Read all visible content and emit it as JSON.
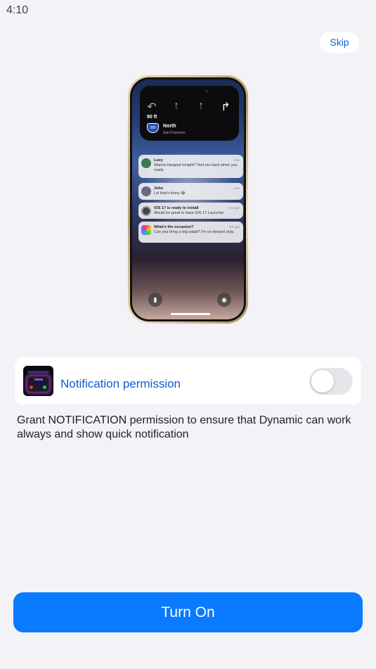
{
  "status": {
    "time": "4:10"
  },
  "header": {
    "skip_label": "Skip"
  },
  "phone": {
    "nav": {
      "distance": "90 ft",
      "route": "280",
      "street": "North",
      "city": "San Francisco"
    },
    "notifications": [
      {
        "title": "Lucy",
        "body": "Wanna hangout tonight? Text me back when you ready",
        "time": "now",
        "icon_color": "#3e7a4c"
      },
      {
        "title": "John",
        "body": "Lol that's funny 😂",
        "time": "now",
        "icon_color": "#6a6a7c"
      },
      {
        "title": "iOS 17 is ready to install",
        "body": "Would be great to have iOS 17 Launcher",
        "time": "1m ago",
        "icon_color": "#444444"
      },
      {
        "title": "What's the occasion?",
        "body": "Can you bring a big salad? I'm on dessert duty.",
        "time": "1m ago",
        "icon_color": "#ffffff"
      }
    ]
  },
  "permission": {
    "label": "Notification permission",
    "enabled": false,
    "description": "Grant NOTIFICATION permission to ensure that Dynamic can work always and show quick notification"
  },
  "footer": {
    "button_label": "Turn On"
  },
  "colors": {
    "accent": "#0a7aff",
    "link": "#0a5fd0",
    "background": "#f2f2f7"
  }
}
